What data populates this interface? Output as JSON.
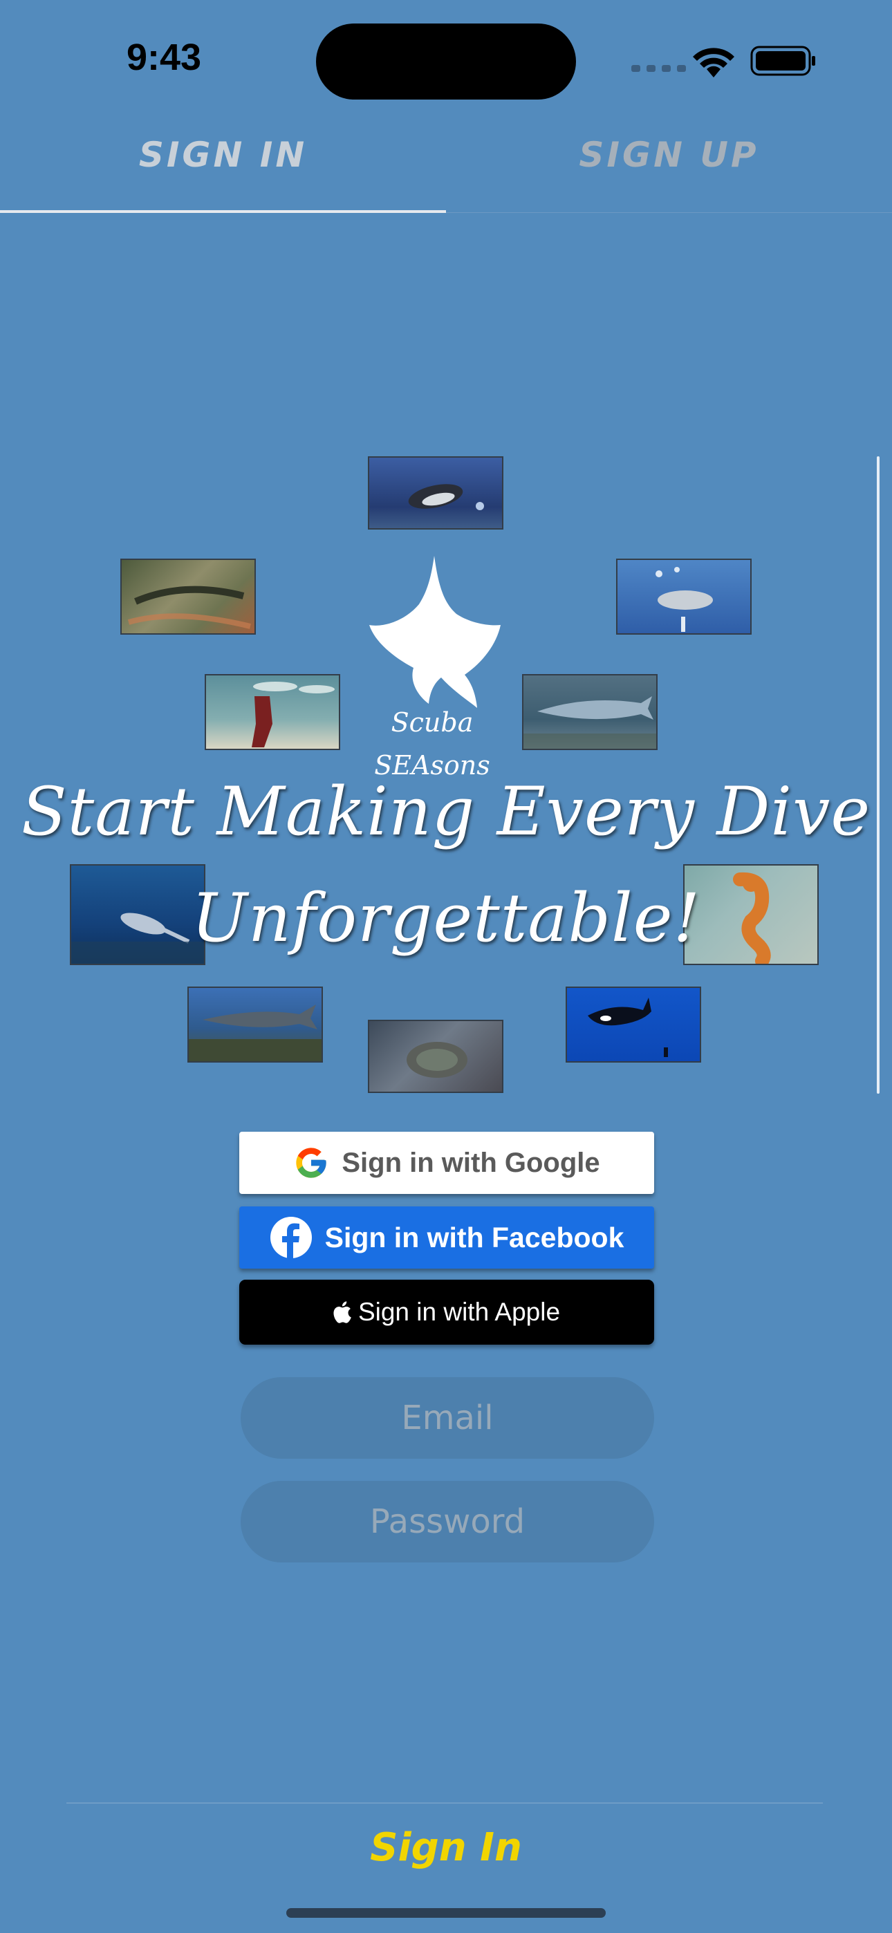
{
  "status_bar": {
    "time": "9:43"
  },
  "tabs": [
    {
      "label": "SIGN IN",
      "active": true
    },
    {
      "label": "SIGN UP",
      "active": false
    }
  ],
  "logo": {
    "line1": "Scuba",
    "line2": "SEAsons"
  },
  "headline": {
    "line1": "Start Making Every Dive",
    "line2": "Unforgettable!"
  },
  "auth": {
    "google": "Sign in with Google",
    "facebook": "Sign in with Facebook",
    "apple": "Sign in with Apple"
  },
  "form": {
    "email_placeholder": "Email",
    "password_placeholder": "Password"
  },
  "footer": {
    "submit_label": "Sign In"
  },
  "colors": {
    "background": "#538bbd",
    "accent": "#f2d500",
    "facebook": "#1a6fe3"
  }
}
